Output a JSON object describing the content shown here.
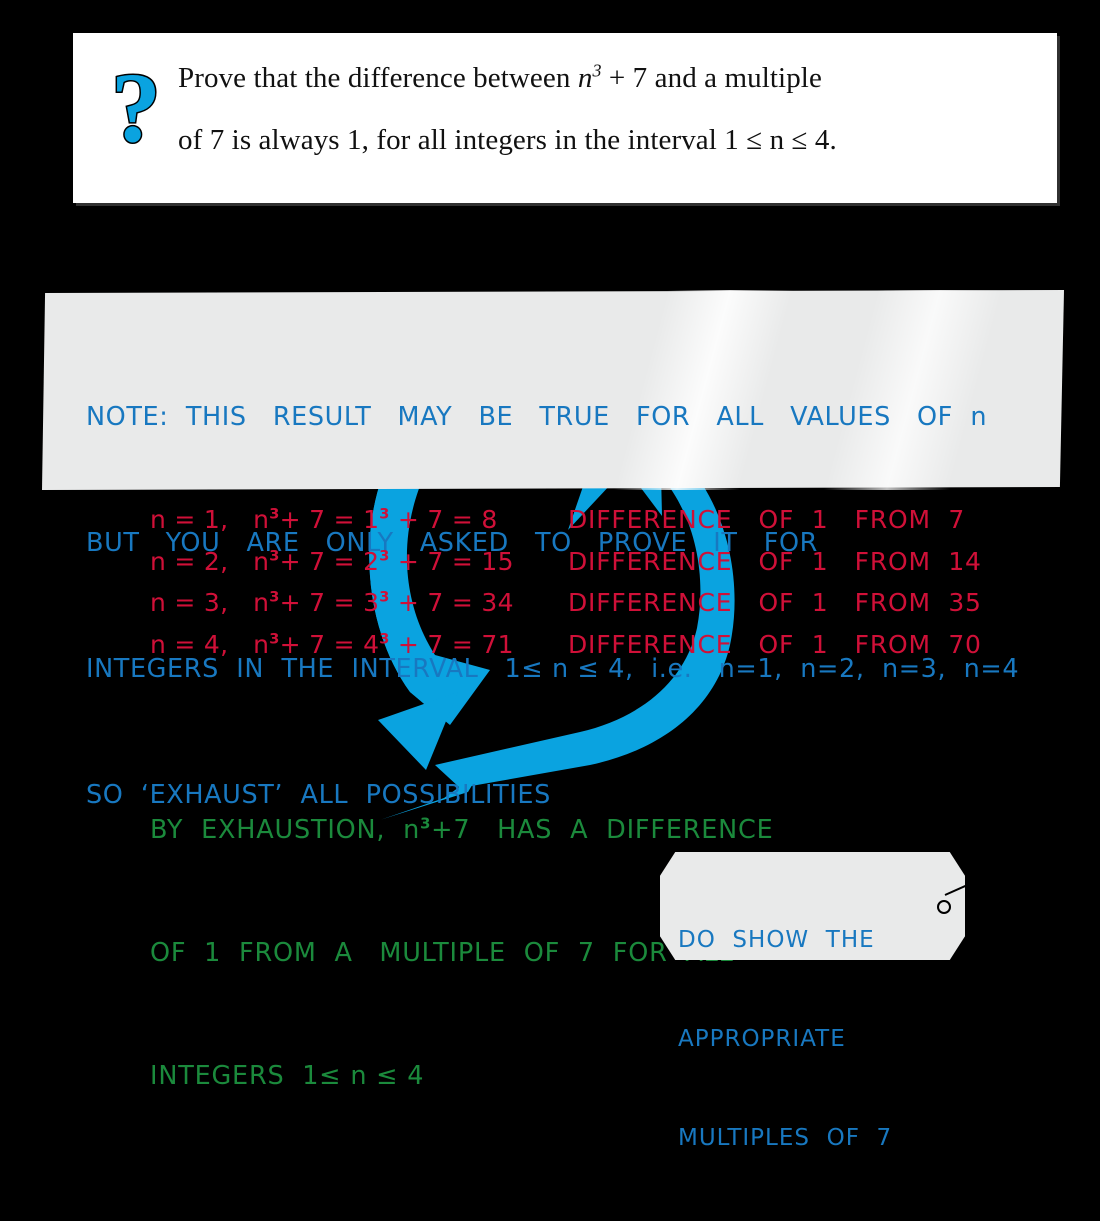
{
  "question": {
    "icon": "question-mark-icon",
    "icon_glyph": "?",
    "icon_color": "#0aa3e0",
    "line1_pre": "Prove that the difference between ",
    "line1_var": "n",
    "line1_sup": "3",
    "line1_mid": " + 7 and a multiple",
    "line2": "of 7 is always 1, for all integers in the interval 1 ≤ n ≤ 4.",
    "full_text": "Prove that the difference between n³ + 7 and a multiple of 7 is always 1, for all integers in the interval 1 ≤ n ≤ 4."
  },
  "note": {
    "color": "#1878c0",
    "line1": "NOTE:  THIS   RESULT   MAY   BE   TRUE   FOR   ALL   VALUES   OF  n",
    "line2": "BUT   YOU   ARE   ONLY   ASKED   TO   PROVE   IT   FOR",
    "line3": "INTEGERS  IN  THE  INTERVAL   1≤ n ≤ 4,  i.e.   n=1,  n=2,  n=3,  n=4",
    "line4": "SO  ‘EXHAUST’  ALL  POSSIBILITIES"
  },
  "working": {
    "color": "#d01038",
    "rows": [
      {
        "left_a": "n = 1,   n",
        "left_sup1": "3",
        "left_b": "+ 7 = 1",
        "left_sup2": "3",
        "left_c": " + 7 = 8",
        "right": "DIFFERENCE   OF  1   FROM  7"
      },
      {
        "left_a": "n = 2,   n",
        "left_sup1": "3",
        "left_b": "+ 7 = 2",
        "left_sup2": "3",
        "left_c": " + 7 = 15",
        "right": "DIFFERENCE   OF  1   FROM  14"
      },
      {
        "left_a": "n = 3,   n",
        "left_sup1": "3",
        "left_b": "+ 7 = 3",
        "left_sup2": "3",
        "left_c": " + 7 = 34",
        "right": "DIFFERENCE   OF  1   FROM  35"
      },
      {
        "left_a": "n = 4,   n",
        "left_sup1": "3",
        "left_b": "+ 7 = 4",
        "left_sup2": "3",
        "left_c": " + 7 = 71",
        "right": "DIFFERENCE   OF  1   FROM  70"
      }
    ]
  },
  "conclusion": {
    "color": "#1b8a3c",
    "line1_a": "BY  EXHAUSTION,  n",
    "line1_sup": "3",
    "line1_b": "+7   HAS  A  DIFFERENCE",
    "line2": "OF  1  FROM  A   MULTIPLE  OF  7  FOR  ALL",
    "line3": "INTEGERS  1≤ n ≤ 4"
  },
  "tag": {
    "color": "#1878c0",
    "line1": "DO  SHOW  THE",
    "line2": "APPROPRIATE",
    "line3": "MULTIPLES  OF  7"
  },
  "decoration": {
    "swoosh_name": "blue-circular-arrow",
    "swoosh_color": "#0aa3e0",
    "background_color": "#000000",
    "panel_color": "#e9eaea",
    "card_color": "#ffffff"
  }
}
